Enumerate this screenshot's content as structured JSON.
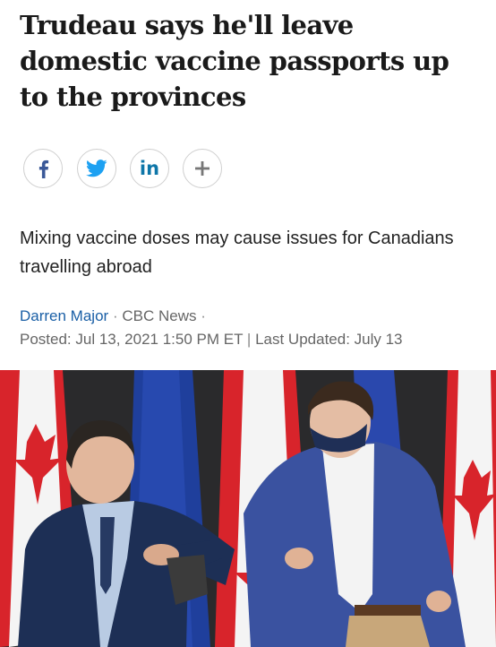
{
  "article": {
    "headline": "Trudeau says he'll leave domestic vaccine passports up to the provinces",
    "deck": "Mixing vaccine doses may cause issues for Canadians travelling abroad",
    "byline": {
      "author": "Darren Major",
      "separator_1": "·",
      "outlet": "CBC News",
      "separator_2": "·",
      "posted": "Posted: Jul 13, 2021 1:50 PM ET",
      "divider": "|",
      "updated": "Last Updated: July 13"
    }
  },
  "share": {
    "facebook_icon": "facebook-icon",
    "twitter_icon": "twitter-icon",
    "linkedin_icon": "linkedin-icon",
    "linkedin_label": "in",
    "more_icon": "plus-icon",
    "more_label": "+"
  },
  "colors": {
    "facebook": "#3b5998",
    "twitter": "#1da1f2",
    "linkedin": "#0e76a8",
    "author_link": "#1a5fa6",
    "meta_text": "#666666"
  }
}
